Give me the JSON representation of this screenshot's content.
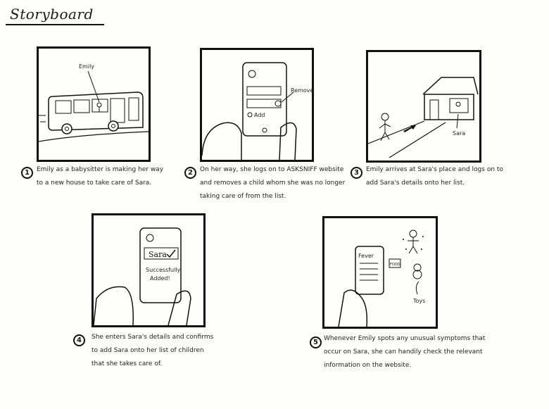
{
  "title": "Storyboard",
  "panels": [
    {
      "number": "1",
      "labels": {
        "emily": "Emily"
      },
      "caption": [
        "Emily as a babysitter is making her way",
        "to a new house to take care of Sara."
      ]
    },
    {
      "number": "2",
      "labels": {
        "remove": "Remove",
        "add": "Add"
      },
      "caption": [
        "On her way, she logs on to ASKSNIFF website",
        "and removes a child whom she was no longer",
        "taking care of from the list."
      ]
    },
    {
      "number": "3",
      "labels": {
        "sara": "Sara"
      },
      "caption": [
        "Emily arrives at Sara's place and logs on to",
        "add Sara's details onto her list."
      ]
    },
    {
      "number": "4",
      "labels": {
        "name": "Sara",
        "success1": "Successfully",
        "success2": "Added!"
      },
      "caption": [
        "She enters Sara's details and confirms",
        "to add Sara onto her list of children",
        "that she takes care of."
      ]
    },
    {
      "number": "5",
      "labels": {
        "fever": "Fever",
        "toys": "Toys",
        "food": "FOOD"
      },
      "caption": [
        "Whenever Emily spots any unusual symptoms that",
        "occur on Sara, she can handily check the relevant",
        "information on the website."
      ]
    }
  ]
}
